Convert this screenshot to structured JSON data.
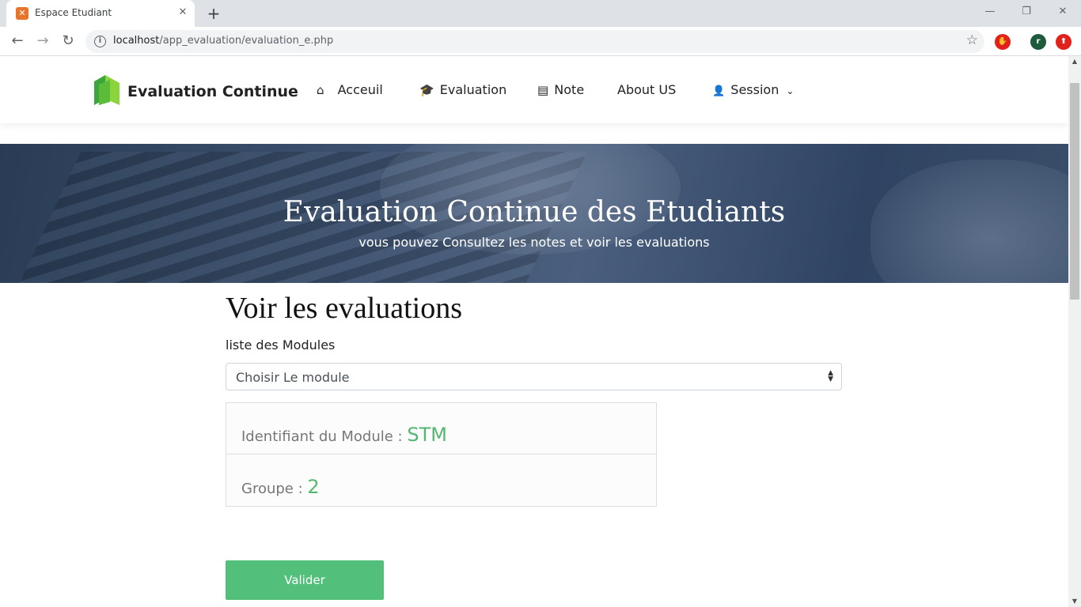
{
  "browser": {
    "tab_title": "Espace Etudiant",
    "url_host": "localhost",
    "url_path": "/app_evaluation/evaluation_e.php",
    "tab_close": "✕",
    "new_tab": "+",
    "win_min": "—",
    "win_max": "❐",
    "win_close": "✕",
    "back": "←",
    "forward": "→",
    "reload": "↻",
    "star": "☆",
    "info": "i",
    "ext_user_initial": "r"
  },
  "navbar": {
    "brand": "Evaluation Continue",
    "items": [
      {
        "icon": "home-icon",
        "glyph": "⌂",
        "label": "Acceuil"
      },
      {
        "icon": "graduation-cap-icon",
        "glyph": "🎓",
        "label": "Evaluation"
      },
      {
        "icon": "list-alt-icon",
        "glyph": "▤",
        "label": "Note"
      },
      {
        "icon": "",
        "glyph": "",
        "label": "About US"
      },
      {
        "icon": "user-icon",
        "glyph": "👤",
        "label": "Session",
        "caret": "⌄"
      }
    ]
  },
  "hero": {
    "title": "Evaluation Continue des Etudiants",
    "subtitle": "vous pouvez Consultez les notes et voir les evaluations"
  },
  "main": {
    "title": "Voir les evaluations",
    "select_label": "liste des Modules",
    "select_value": "Choisir Le module",
    "module_id_label": "Identifiant du Module : ",
    "module_id_value": "STM",
    "group_label": "Groupe : ",
    "group_value": "2",
    "submit_label": "Valider"
  },
  "colors": {
    "accent_green": "#52c07a",
    "value_green": "#52b870"
  }
}
